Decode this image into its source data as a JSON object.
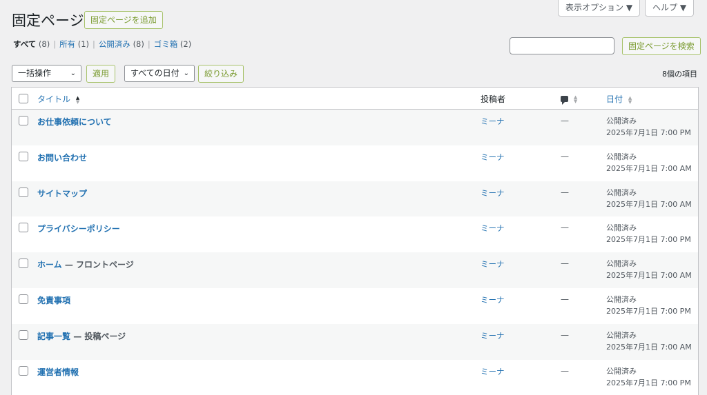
{
  "header": {
    "title": "固定ページ",
    "add_new_label": "固定ページを追加",
    "screen_options_label": "表示オプション ▼",
    "help_label": "ヘルプ ▼"
  },
  "views": [
    {
      "label": "すべて",
      "count": "(8)",
      "current": true
    },
    {
      "label": "所有",
      "count": "(1)"
    },
    {
      "label": "公開済み",
      "count": "(8)"
    },
    {
      "label": "ゴミ箱",
      "count": "(2)"
    }
  ],
  "search": {
    "placeholder": "",
    "button_label": "固定ページを検索"
  },
  "tablenav": {
    "bulk_actions": "一括操作",
    "apply_label": "適用",
    "date_filter": "すべての日付",
    "filter_label": "絞り込み",
    "items_count": "8個の項目"
  },
  "columns": {
    "title": "タイトル",
    "author": "投稿者",
    "comments_icon": "comment-bubble-icon",
    "date": "日付"
  },
  "rows": [
    {
      "title": "お仕事依頼について",
      "state": "",
      "author": "ミーナ",
      "comments": "—",
      "status": "公開済み",
      "date": "2025年7月1日 7:00 PM"
    },
    {
      "title": "お問い合わせ",
      "state": "",
      "author": "ミーナ",
      "comments": "—",
      "status": "公開済み",
      "date": "2025年7月1日 7:00 AM"
    },
    {
      "title": "サイトマップ",
      "state": "",
      "author": "ミーナ",
      "comments": "—",
      "status": "公開済み",
      "date": "2025年7月1日 7:00 AM"
    },
    {
      "title": "プライバシーポリシー",
      "state": "",
      "author": "ミーナ",
      "comments": "—",
      "status": "公開済み",
      "date": "2025年7月1日 7:00 PM"
    },
    {
      "title": "ホーム",
      "state": " — フロントページ",
      "author": "ミーナ",
      "comments": "—",
      "status": "公開済み",
      "date": "2025年7月1日 7:00 AM"
    },
    {
      "title": "免責事項",
      "state": "",
      "author": "ミーナ",
      "comments": "—",
      "status": "公開済み",
      "date": "2025年7月1日 7:00 PM"
    },
    {
      "title": "記事一覧",
      "state": " — 投稿ページ",
      "author": "ミーナ",
      "comments": "—",
      "status": "公開済み",
      "date": "2025年7月1日 7:00 AM"
    },
    {
      "title": "運営者情報",
      "state": "",
      "author": "ミーナ",
      "comments": "—",
      "status": "公開済み",
      "date": "2025年7月1日 7:00 PM"
    }
  ],
  "colors": {
    "link": "#2271b1",
    "button_outline": "#a7c26a",
    "row_alt": "#f6f7f7"
  }
}
